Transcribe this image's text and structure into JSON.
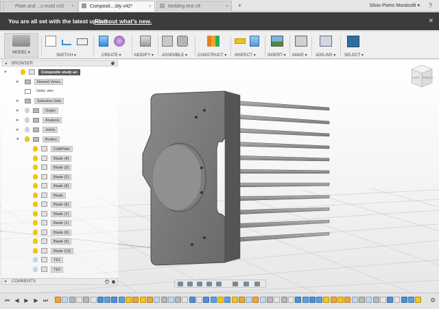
{
  "tabs": [
    {
      "label": "Plate and ...s mold v20",
      "active": false
    },
    {
      "label": "Composit....bly v42*",
      "active": true
    },
    {
      "label": "Molding test v9",
      "active": false
    }
  ],
  "user": {
    "name": "Silvio Pietro Monticelli ▾"
  },
  "banner": {
    "message": "You are all set with the latest update.",
    "link": "Find out what's new.",
    "close": "✕"
  },
  "toolbar": {
    "model": "MODEL ▾",
    "sketch": "SKETCH ▾",
    "create": "CREATE ▾",
    "modify": "MODIFY ▾",
    "assemble": "ASSEMBLE ▾",
    "construct": "CONSTRUCT ▾",
    "inspect": "INSPECT ▾",
    "insert": "INSERT ▾",
    "make": "MAKE ▾",
    "addins": "ADD-INS ▾",
    "select": "SELECT ▾",
    "colors": {
      "accent": "#0696d7",
      "select_bg": "#2f6f9f"
    }
  },
  "browser": {
    "title": "BROWSER",
    "root": "Composite study an",
    "named_views": "Named Views",
    "units": "Units: mm",
    "selection_sets": "Selection Sets",
    "origin": "Origin",
    "analysis": "Analysis",
    "joints": "Joints",
    "bodies": "Bodies",
    "body_items": [
      "ColdPlate",
      "Blade (4)",
      "Blade (3)",
      "Blade (2)",
      "Blade (8)",
      "Blade",
      "Blade (9)",
      "Blade (7)",
      "Blade (1)",
      "Blade (6)",
      "Blade (5)",
      "Blade (10)",
      "TE1",
      "TE2"
    ]
  },
  "viewcube": {
    "left": "LEFT",
    "front": "FRONT"
  },
  "comments": {
    "title": "COMMENTS",
    "add": "+"
  },
  "timeline": {
    "controls": [
      "⏮",
      "◀",
      "▶",
      "▶",
      "⏭"
    ],
    "feature_count": 52
  }
}
